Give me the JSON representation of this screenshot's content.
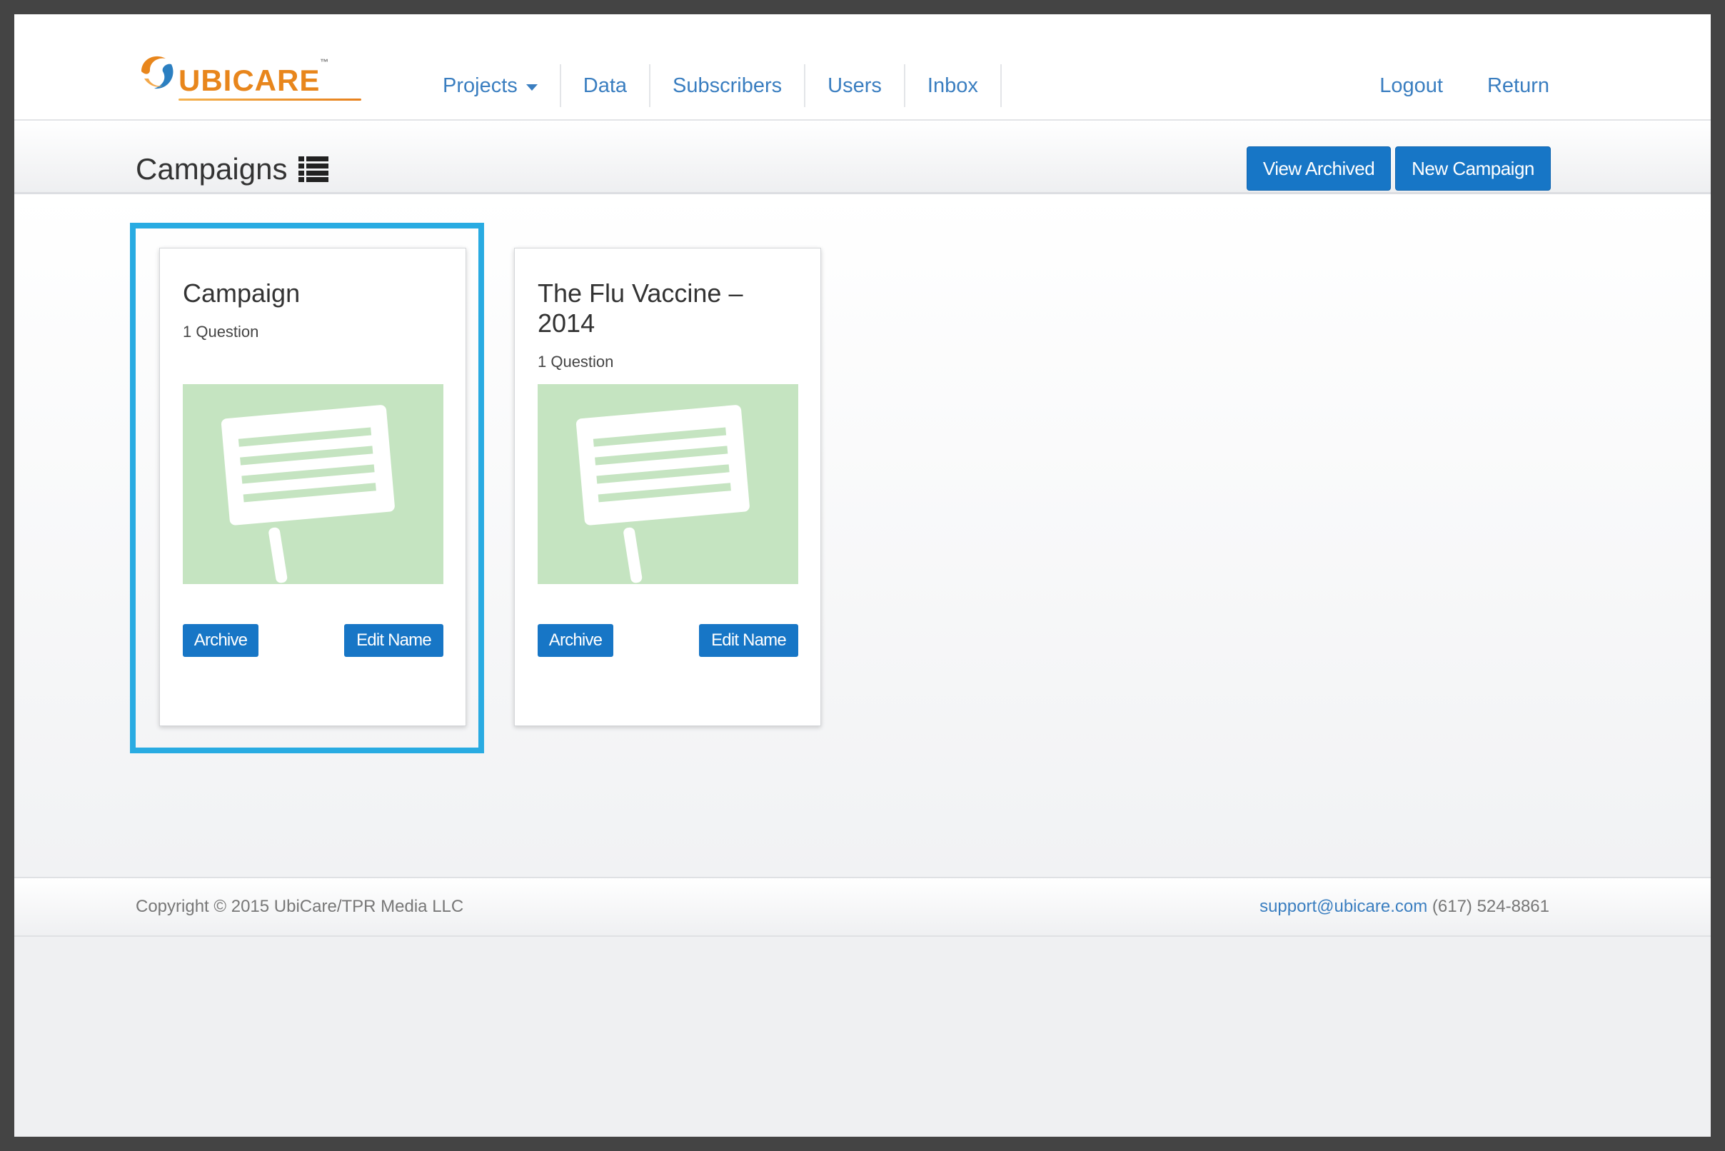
{
  "brand": {
    "name_ubi": "UBI",
    "name_care": "CARE",
    "tm": "™",
    "accent": "#e8861c",
    "logo_icon": "ubicare-swirl-icon"
  },
  "nav": {
    "items": [
      {
        "label": "Projects",
        "has_caret": true
      },
      {
        "label": "Data"
      },
      {
        "label": "Subscribers"
      },
      {
        "label": "Users"
      },
      {
        "label": "Inbox"
      }
    ],
    "right": [
      {
        "label": "Logout"
      },
      {
        "label": "Return"
      }
    ],
    "link_color": "#3a7ec0"
  },
  "header": {
    "title": "Campaigns",
    "title_icon": "list-icon",
    "view_archived_label": "View Archived",
    "new_campaign_label": "New Campaign",
    "button_color": "#1776c6"
  },
  "campaigns": [
    {
      "title": "Campaign",
      "subtitle": "1 Question",
      "image_icon": "sign-placard-icon",
      "archive_label": "Archive",
      "edit_label": "Edit Name",
      "selected": true
    },
    {
      "title": "The Flu Vaccine – 2014",
      "subtitle": "1 Question",
      "image_icon": "sign-placard-icon",
      "archive_label": "Archive",
      "edit_label": "Edit Name",
      "selected": false
    }
  ],
  "footer": {
    "copyright": "Copyright © 2015 UbiCare/TPR Media LLC",
    "email": "support@ubicare.com",
    "phone": "(617) 524-8861"
  },
  "colors": {
    "highlight": "#29abe2",
    "image_bg": "#c5e4c1"
  }
}
